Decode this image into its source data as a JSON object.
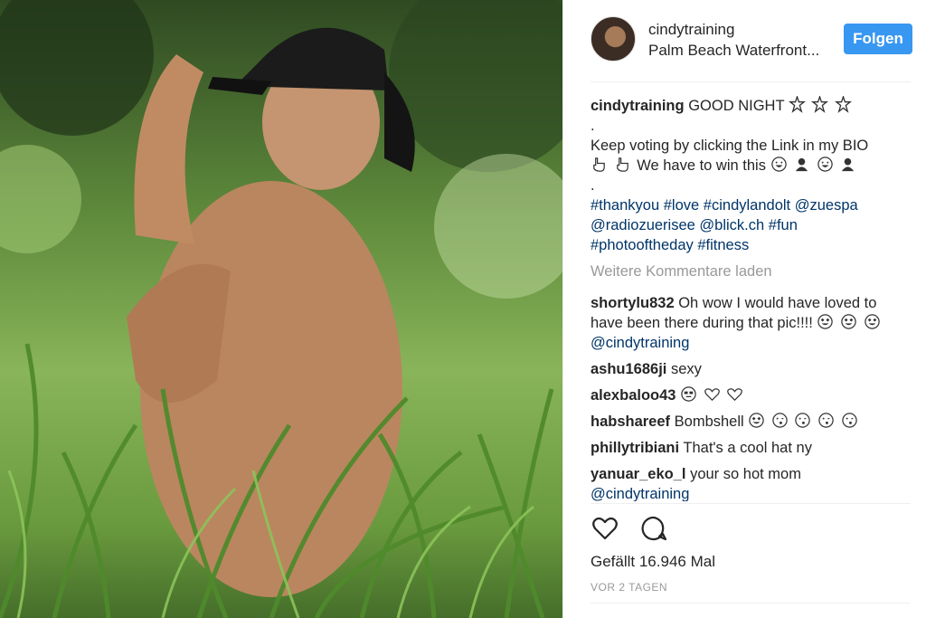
{
  "post": {
    "author": "cindytraining",
    "location": "Palm Beach Waterfront...",
    "follow_label": "Folgen"
  },
  "caption": {
    "username": "cindytraining",
    "line1": "GOOD NIGHT",
    "line2": ".",
    "line3": "Keep voting by clicking the Link in my BIO",
    "line4": "We have to win this",
    "line5": ".",
    "hashtags": [
      "#thankyou",
      "#love",
      "#cindylandolt",
      "@zuespa",
      "@radiozuerisee",
      "@blick.ch",
      "#fun",
      "#photooftheday",
      "#fitness"
    ]
  },
  "load_more_label": "Weitere Kommentare laden",
  "comments": [
    {
      "user": "shortylu832",
      "text": "Oh wow I would have loved to have been there during that pic!!!!",
      "mention": "@cindytraining"
    },
    {
      "user": "ashu1686ji",
      "text": "sexy"
    },
    {
      "user": "alexbaloo43",
      "text": ""
    },
    {
      "user": "habshareef",
      "text": "Bombshell"
    },
    {
      "user": "phillytribiani",
      "text": "That's a cool hat ny"
    },
    {
      "user": "yanuar_eko_l",
      "text": "your so hot mom",
      "mention": "@cindytraining"
    }
  ],
  "likes_label": "Gefällt 16.946 Mal",
  "time_label": "VOR 2 TAGEN",
  "icons": {
    "like": "heart-icon",
    "comment": "comment-bubble-icon"
  },
  "colors": {
    "accent": "#3897f0",
    "link": "#003569",
    "muted": "#999999"
  }
}
